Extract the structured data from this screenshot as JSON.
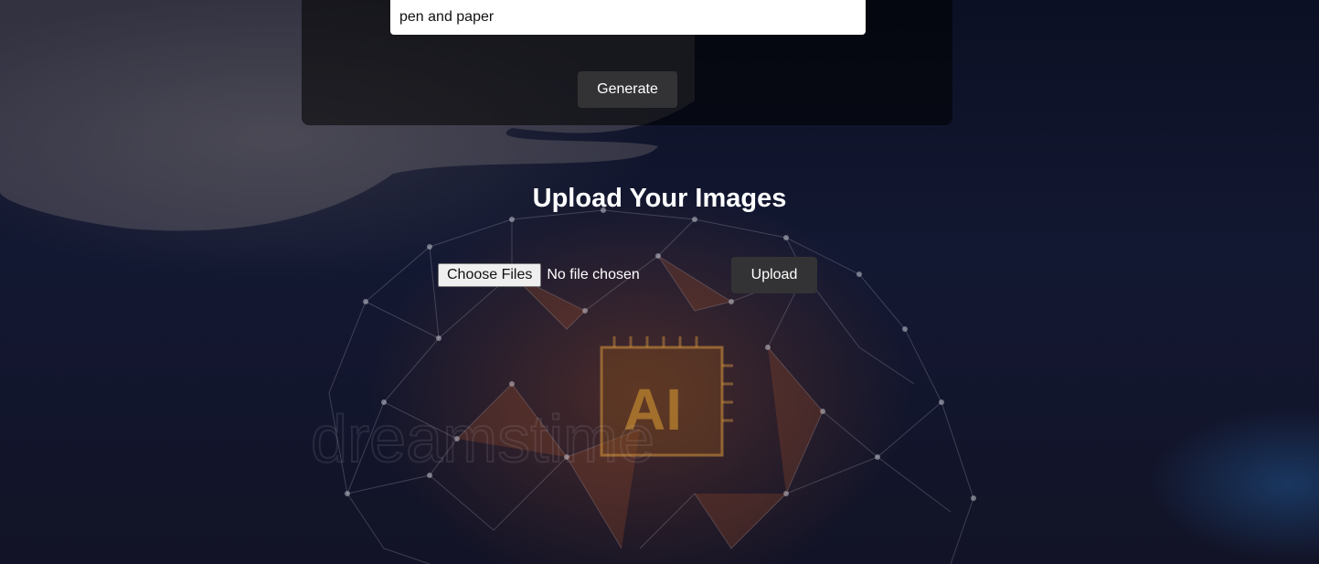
{
  "generate": {
    "prompt_value": "pen and paper",
    "button_label": "Generate"
  },
  "upload": {
    "title": "Upload Your Images",
    "choose_label": "Choose Files",
    "status": "No file chosen",
    "button_label": "Upload"
  },
  "background": {
    "chip_text": "AI",
    "watermark": "dreamstime"
  },
  "colors": {
    "button_bg": "#333335",
    "panel_bg": "rgba(0,0,0,0.55)"
  }
}
